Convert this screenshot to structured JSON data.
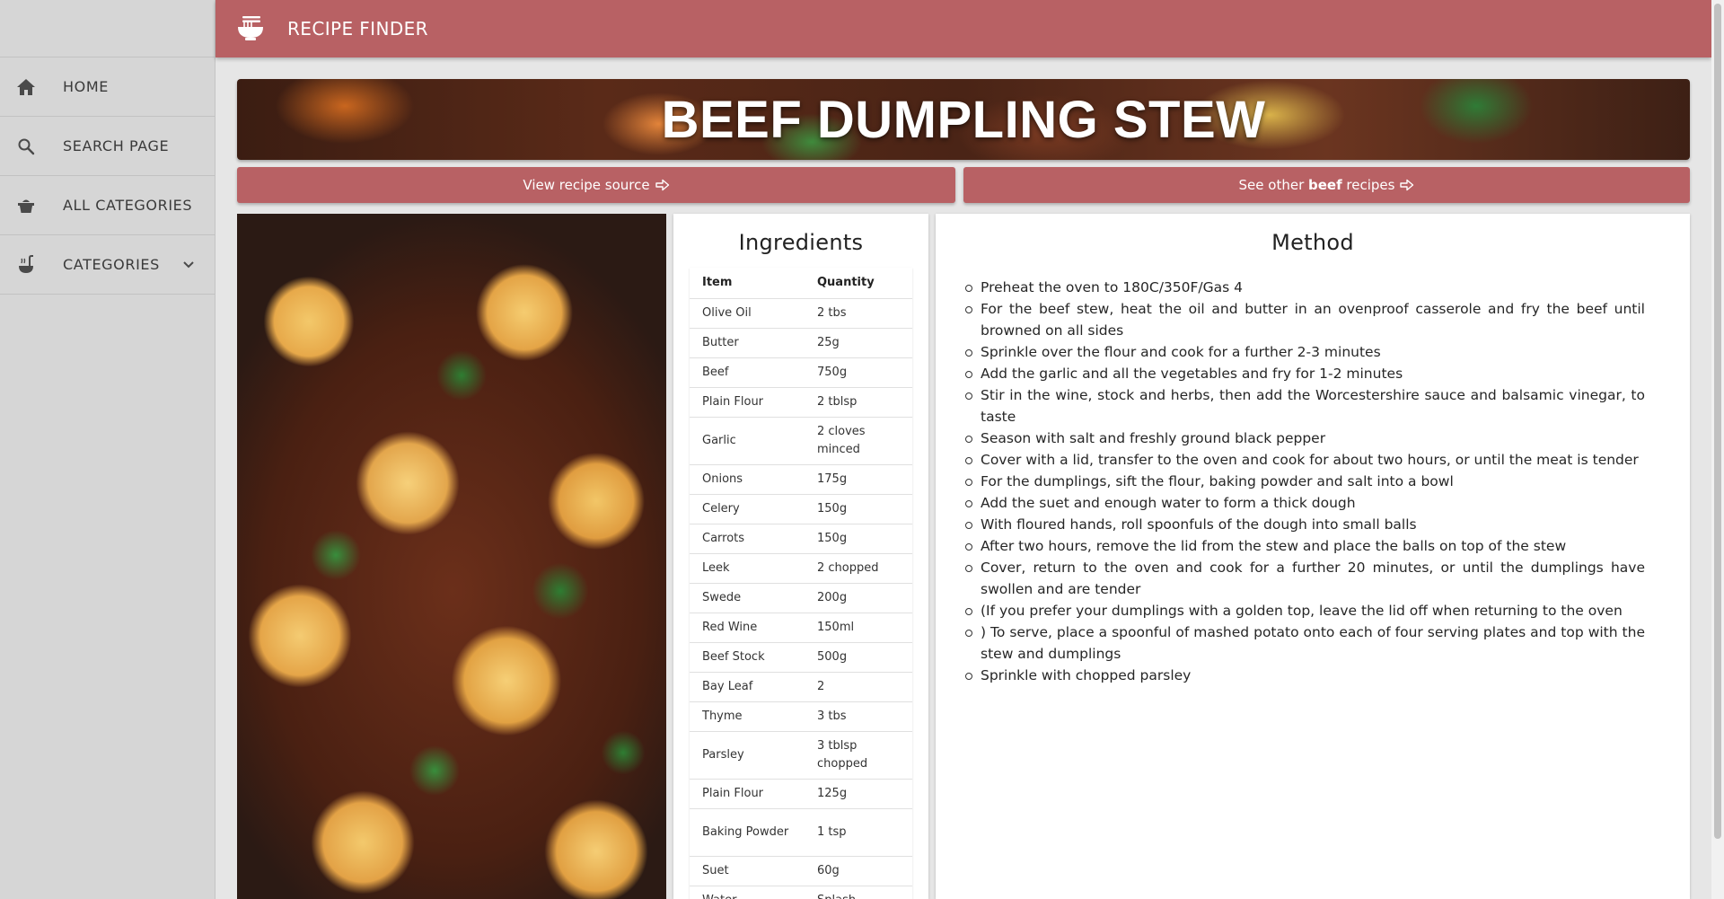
{
  "app": {
    "title": "RECIPE FINDER",
    "logo_icon": "noodle-bowl-icon",
    "accent_color": "#b86164"
  },
  "sidebar": {
    "items": [
      {
        "label": "HOME",
        "icon": "home-icon"
      },
      {
        "label": "SEARCH PAGE",
        "icon": "search-icon"
      },
      {
        "label": "ALL CATEGORIES",
        "icon": "pot-icon"
      },
      {
        "label": "CATEGORIES",
        "icon": "ladle-icon",
        "expand_icon": "chevron-down-icon"
      }
    ]
  },
  "recipe": {
    "title": "BEEF DUMPLING STEW",
    "source_button": "View recipe source",
    "other_prefix": "See other ",
    "other_category": "beef",
    "other_suffix": " recipes",
    "arrow_icon": "arrow-right-icon"
  },
  "ingredients": {
    "heading": "Ingredients",
    "columns": {
      "item": "Item",
      "quantity": "Quantity"
    },
    "rows": [
      {
        "item": "Olive Oil",
        "quantity": "2 tbs"
      },
      {
        "item": "Butter",
        "quantity": "25g"
      },
      {
        "item": "Beef",
        "quantity": "750g"
      },
      {
        "item": "Plain Flour",
        "quantity": "2 tblsp"
      },
      {
        "item": "Garlic",
        "quantity": "2 cloves minced"
      },
      {
        "item": "Onions",
        "quantity": "175g"
      },
      {
        "item": "Celery",
        "quantity": "150g"
      },
      {
        "item": "Carrots",
        "quantity": "150g"
      },
      {
        "item": "Leek",
        "quantity": "2 chopped"
      },
      {
        "item": "Swede",
        "quantity": "200g"
      },
      {
        "item": "Red Wine",
        "quantity": "150ml"
      },
      {
        "item": "Beef Stock",
        "quantity": "500g"
      },
      {
        "item": "Bay Leaf",
        "quantity": "2"
      },
      {
        "item": "Thyme",
        "quantity": "3 tbs"
      },
      {
        "item": "Parsley",
        "quantity": "3 tblsp chopped"
      },
      {
        "item": "Plain Flour",
        "quantity": "125g"
      },
      {
        "item": "Baking Powder",
        "quantity": "1 tsp"
      },
      {
        "item": "Suet",
        "quantity": "60g"
      },
      {
        "item": "Water",
        "quantity": "Splash"
      }
    ]
  },
  "method": {
    "heading": "Method",
    "steps": [
      "Preheat the oven to 180C/350F/Gas 4",
      "For the beef stew, heat the oil and butter in an ovenproof casserole and fry the beef until browned on all sides",
      "Sprinkle over the flour and cook for a further 2-3 minutes",
      "Add the garlic and all the vegetables and fry for 1-2 minutes",
      "Stir in the wine, stock and herbs, then add the Worcestershire sauce and balsamic vinegar, to taste",
      "Season with salt and freshly ground black pepper",
      "Cover with a lid, transfer to the oven and cook for about two hours, or until the meat is tender",
      "For the dumplings, sift the flour, baking powder and salt into a bowl",
      "Add the suet and enough water to form a thick dough",
      "With floured hands, roll spoonfuls of the dough into small balls",
      "After two hours, remove the lid from the stew and place the balls on top of the stew",
      "Cover, return to the oven and cook for a further 20 minutes, or until the dumplings have swollen and are tender",
      "(If you prefer your dumplings with a golden top, leave the lid off when returning to the oven",
      ") To serve, place a spoonful of mashed potato onto each of four serving plates and top with the stew and dumplings",
      "Sprinkle with chopped parsley"
    ]
  }
}
